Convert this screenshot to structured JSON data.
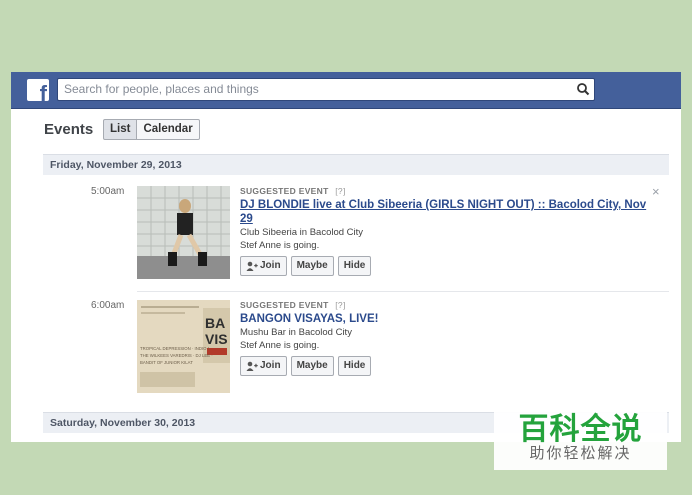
{
  "search": {
    "placeholder": "Search for people, places and things"
  },
  "page": {
    "title": "Events"
  },
  "tabs": [
    {
      "label": "List",
      "active": true
    },
    {
      "label": "Calendar",
      "active": false
    }
  ],
  "dates": [
    "Friday, November 29, 2013",
    "Saturday, November 30, 2013"
  ],
  "events": [
    {
      "time": "5:00am",
      "suggested": "SUGGESTED EVENT",
      "help": "[?]",
      "title": "DJ BLONDIE live at Club Sibeeria (GIRLS NIGHT OUT) :: Bacolod City, Nov 29",
      "venue": "Club Sibeeria in Bacolod City",
      "going": "Stef Anne is going.",
      "buttons": {
        "join": "Join",
        "maybe": "Maybe",
        "hide": "Hide"
      }
    },
    {
      "time": "6:00am",
      "suggested": "SUGGESTED EVENT",
      "help": "[?]",
      "title": "BANGON VISAYAS, LIVE!",
      "venue": "Mushu Bar in Bacolod City",
      "going": "Stef Anne is going.",
      "buttons": {
        "join": "Join",
        "maybe": "Maybe",
        "hide": "Hide"
      }
    }
  ],
  "close_glyph": "×",
  "poster": {
    "lines": [
      "TROPICAL DEPRESSION · INDIO I",
      "THE WILKEES VAREDRIS · DJ LEE ·",
      "BANDIT OF JUNIOR KILAT"
    ],
    "side": [
      "BA",
      "VIS"
    ]
  },
  "watermark": {
    "brand": "百科全说",
    "tagline": "助你轻松解决"
  },
  "colors": {
    "facebook_blue": "#44609b",
    "link": "#2b4a8c",
    "background": "#c3d9b5",
    "watermark_green": "#24a33c"
  }
}
